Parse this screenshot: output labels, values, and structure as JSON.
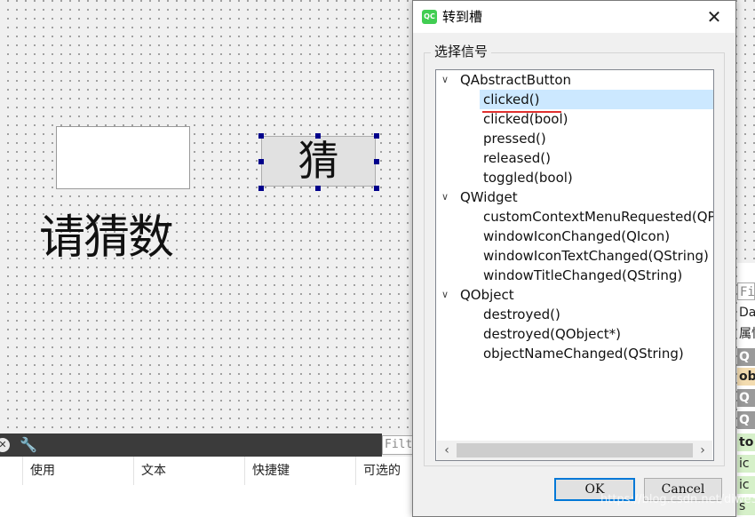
{
  "canvas": {
    "big_label": "请猜数",
    "guess_button": "猜"
  },
  "action_editor": {
    "filter_placeholder": "Filter",
    "columns": [
      "使用",
      "文本",
      "快捷键",
      "可选的"
    ]
  },
  "property_panel": {
    "rows": [
      "Filt",
      "Dashb",
      "属性",
      "Q",
      "ob",
      "Q",
      "Q",
      "to",
      "ic",
      "ic",
      "s"
    ],
    "colors": {
      "header": "#9a9a9a",
      "highlight": "#f3dcb0",
      "green": "#d6f0c9"
    }
  },
  "dialog": {
    "title": "转到槽",
    "icon_text": "QC",
    "group_label": "选择信号",
    "tree": [
      {
        "name": "QAbstractButton",
        "children": [
          "clicked()",
          "clicked(bool)",
          "pressed()",
          "released()",
          "toggled(bool)"
        ]
      },
      {
        "name": "QWidget",
        "children": [
          "customContextMenuRequested(QPoint)",
          "windowIconChanged(QIcon)",
          "windowIconTextChanged(QString)",
          "windowTitleChanged(QString)"
        ]
      },
      {
        "name": "QObject",
        "children": [
          "destroyed()",
          "destroyed(QObject*)",
          "objectNameChanged(QString)"
        ]
      }
    ],
    "selected": "clicked()",
    "ok_label": "OK",
    "cancel_label": "Cancel"
  },
  "watermark": "https://blog.csdn.net/diwe388",
  "colors": {
    "selection": "#cce8ff",
    "underline": "#e0302e",
    "ok_border": "#0078d7"
  }
}
